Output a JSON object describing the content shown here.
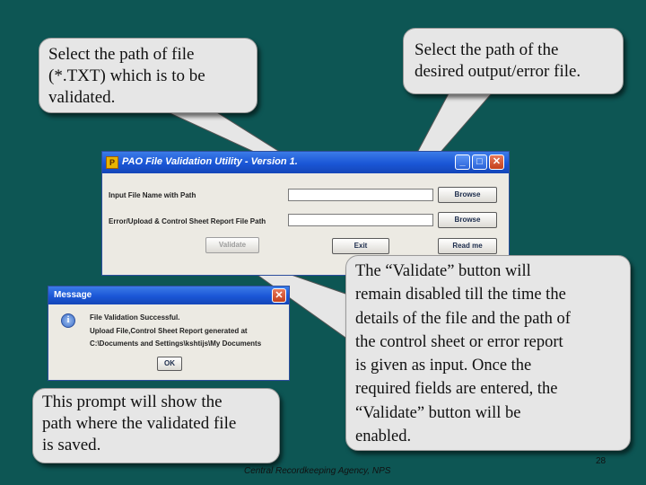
{
  "callouts": {
    "input_path": "Select the path of file\n(*.TXT) which is to be\nvalidated.",
    "output_path": "Select the path of the\ndesired output/error file.",
    "validate_note": "The “Validate” button will\nremain disabled till the time the\ndetails of the file and the path of\nthe control sheet or error report\nis given as input. Once the\nrequired fields are entered, the\n“Validate” button will be\nenabled.",
    "prompt_note": "This prompt will show the\npath where the validated file\nis saved."
  },
  "window": {
    "title": "PAO File Validation Utility - Version 1.",
    "input_label": "Input File Name with Path",
    "input_value": "",
    "output_label": "Error/Upload & Control Sheet Report File Path",
    "output_value": "",
    "browse_input": "Browse",
    "browse_output": "Browse",
    "validate": "Validate",
    "exit": "Exit",
    "readme": "Read me",
    "title_buttons": {
      "minimize": "_",
      "maximize": "□",
      "close": "✕"
    }
  },
  "dialog": {
    "title": "Message",
    "line1": "File Validation Successful.",
    "line2": "Upload File,Control Sheet Report generated at",
    "line3": "C:\\Documents and Settings\\kshtijs\\My Documents",
    "ok": "OK",
    "close": "✕"
  },
  "footer": "Central Recordkeeping Agency, NPS",
  "page_number": "28",
  "icons": {
    "app_icon": "app-logo-icon",
    "info_icon": "information-icon"
  },
  "colors": {
    "background": "#0d5654",
    "callout": "#e6e6e6",
    "titlebar": "#1a56d6"
  }
}
